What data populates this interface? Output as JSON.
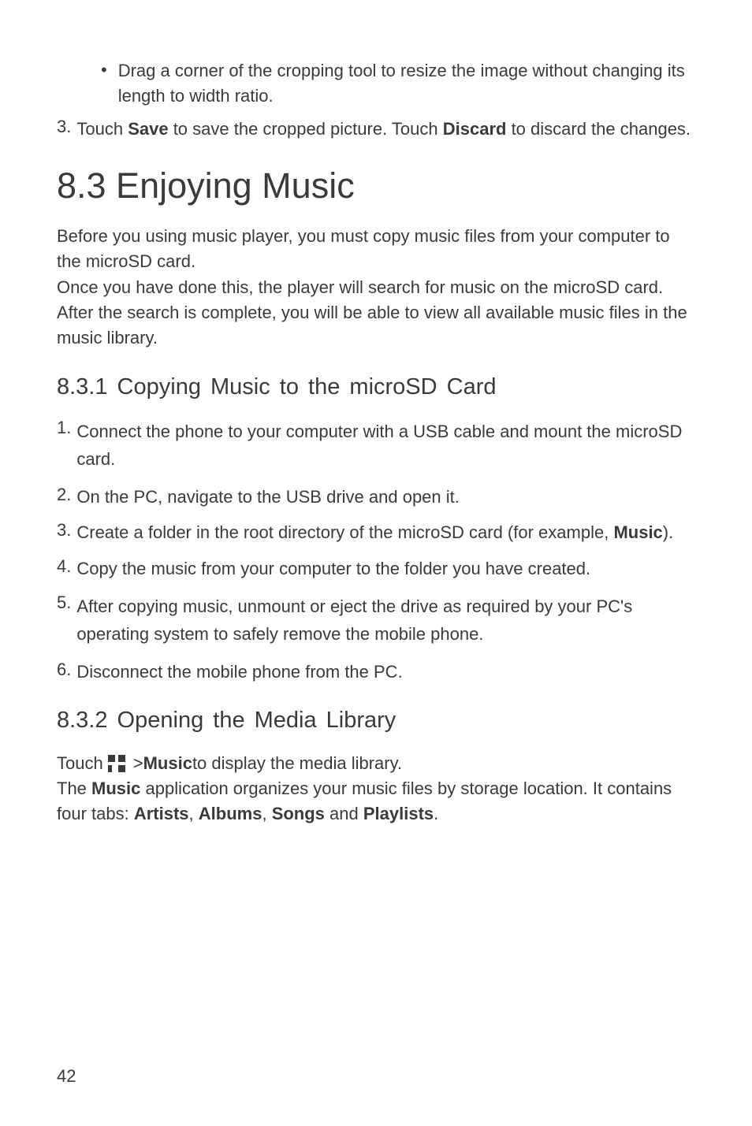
{
  "bullet": {
    "text": "Drag a corner of the cropping tool to resize the image without changing its length to width ratio."
  },
  "step3": {
    "n": "3.",
    "t1": "Touch ",
    "b1": "Save",
    "t2": " to save the cropped picture. Touch ",
    "b2": "Discard",
    "t3": " to discard the changes."
  },
  "h1": "8.3  Enjoying Music",
  "p1": "Before you using music player, you must copy music files from your computer to the microSD card.",
  "p2": "Once you have done this, the player will search for music on the microSD card. After the search is complete, you will be able to view all available music files in the music library.",
  "h2a": "8.3.1  Copying Music to the microSD Card",
  "copy": {
    "n1": "1.",
    "t1": "Connect the phone to your computer with a USB cable and mount the microSD card.",
    "n2": "2.",
    "t2": "On the PC, navigate to the USB drive and open it.",
    "n3": "3.",
    "t3a": "Create a folder in the root directory of the microSD card (for example, ",
    "t3b": "Music",
    "t3c": ").",
    "n4": "4.",
    "t4": "Copy the music from your computer to the folder you have created.",
    "n5": "5.",
    "t5": "After copying music, unmount or eject the drive as required by your PC's operating system to safely remove the mobile phone.",
    "n6": "6.",
    "t6": "Disconnect the mobile phone from the PC."
  },
  "h2b": "8.3.2  Opening the Media Library",
  "media": {
    "touch": "Touch",
    "gt": " > ",
    "music": "Music",
    "rest": " to display the media library.",
    "p_a": "The ",
    "p_b": "Music",
    "p_c": " application organizes your music files by storage location. It contains four tabs: ",
    "b1": "Artists",
    "s1": ", ",
    "b2": "Albums",
    "s2": ", ",
    "b3": "Songs",
    "s3": " and ",
    "b4": "Playlists",
    "s4": "."
  },
  "pagenum": "42"
}
